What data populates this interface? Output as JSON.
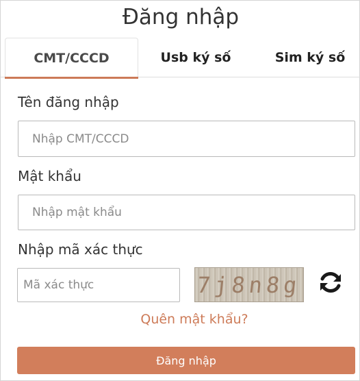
{
  "title": "Đăng nhập",
  "tabs": [
    {
      "label": "CMT/CCCD",
      "active": true
    },
    {
      "label": "Usb ký số",
      "active": false
    },
    {
      "label": "Sim ký số",
      "active": false
    }
  ],
  "form": {
    "username_label": "Tên đăng nhập",
    "username_placeholder": "Nhập CMT/CCCD",
    "password_label": "Mật khẩu",
    "password_placeholder": "Nhập mật khẩu",
    "captcha_label": "Nhập mã xác thực",
    "captcha_placeholder": "Mã xác thực",
    "captcha_code": "7j8n8g",
    "forgot_link": "Quên mật khẩu?",
    "submit_label": "Đăng nhập"
  },
  "icons": {
    "refresh": "refresh-icon"
  },
  "colors": {
    "accent": "#d27e5b",
    "link": "#cd7b58"
  }
}
